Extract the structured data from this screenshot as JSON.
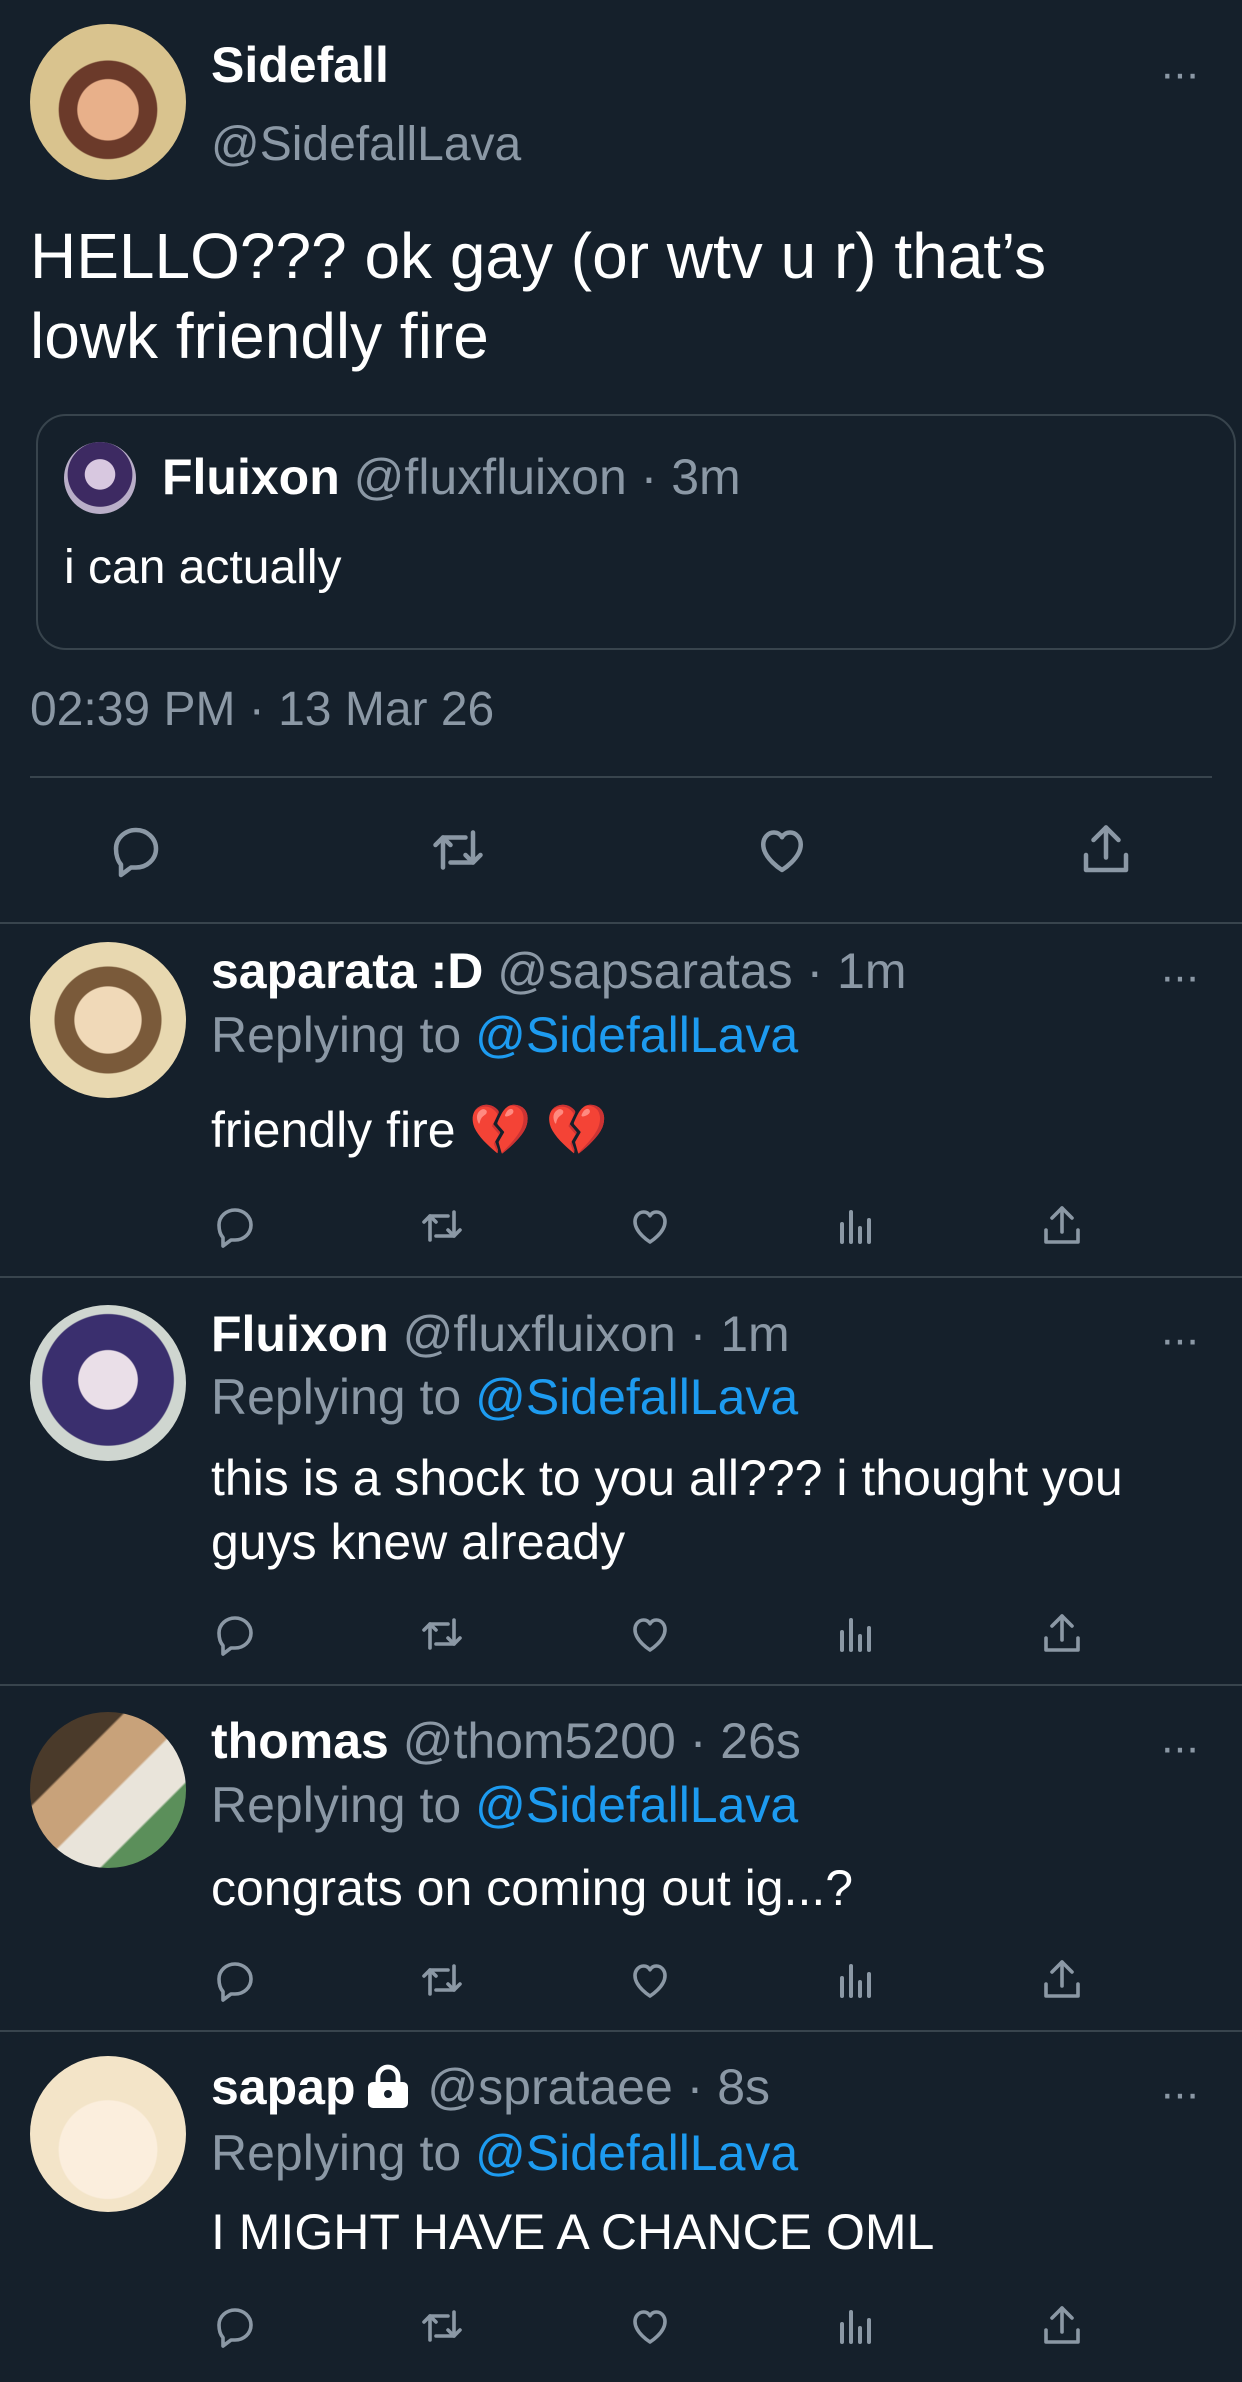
{
  "main_tweet": {
    "name": "Sidefall",
    "handle": "@SidefallLava",
    "text": "HELLO??? ok gay (or wtv u r) that’s lowk friendly fire",
    "quoted": {
      "name": "Fluixon",
      "meta": "@fluxfluixon · 3m",
      "text": "i can actually"
    },
    "timestamp": "02:39 PM · 13 Mar 26",
    "more": "···"
  },
  "replies": [
    {
      "name": "saparata :D",
      "meta": "@sapsaratas · 1m",
      "replying_prefix": "Replying to",
      "replying_to": "@SidefallLava",
      "text": "friendly fire 💔 💔",
      "more": "···"
    },
    {
      "name": "Fluixon",
      "meta": "@fluxfluixon · 1m",
      "replying_prefix": "Replying to",
      "replying_to": "@SidefallLava",
      "text": "this is a shock to you all??? i thought you guys knew already",
      "more": "···"
    },
    {
      "name": "thomas",
      "meta": "@thom5200 · 26s",
      "replying_prefix": "Replying to",
      "replying_to": "@SidefallLava",
      "text": "congrats on coming out ig...?",
      "more": "···"
    },
    {
      "name": "sapap",
      "meta": "@sprataee · 8s",
      "replying_prefix": "Replying to",
      "replying_to": "@SidefallLava",
      "text": "I MIGHT HAVE A CHANCE OML",
      "more": "···"
    }
  ],
  "colors": {
    "background": "#15202b",
    "muted_text": "#8b98a5",
    "divider": "#38444d",
    "link": "#1d9bf0"
  },
  "icons": [
    "reply-icon",
    "retweet-icon",
    "like-icon",
    "views-icon",
    "share-icon",
    "lock-icon",
    "more-icon"
  ]
}
